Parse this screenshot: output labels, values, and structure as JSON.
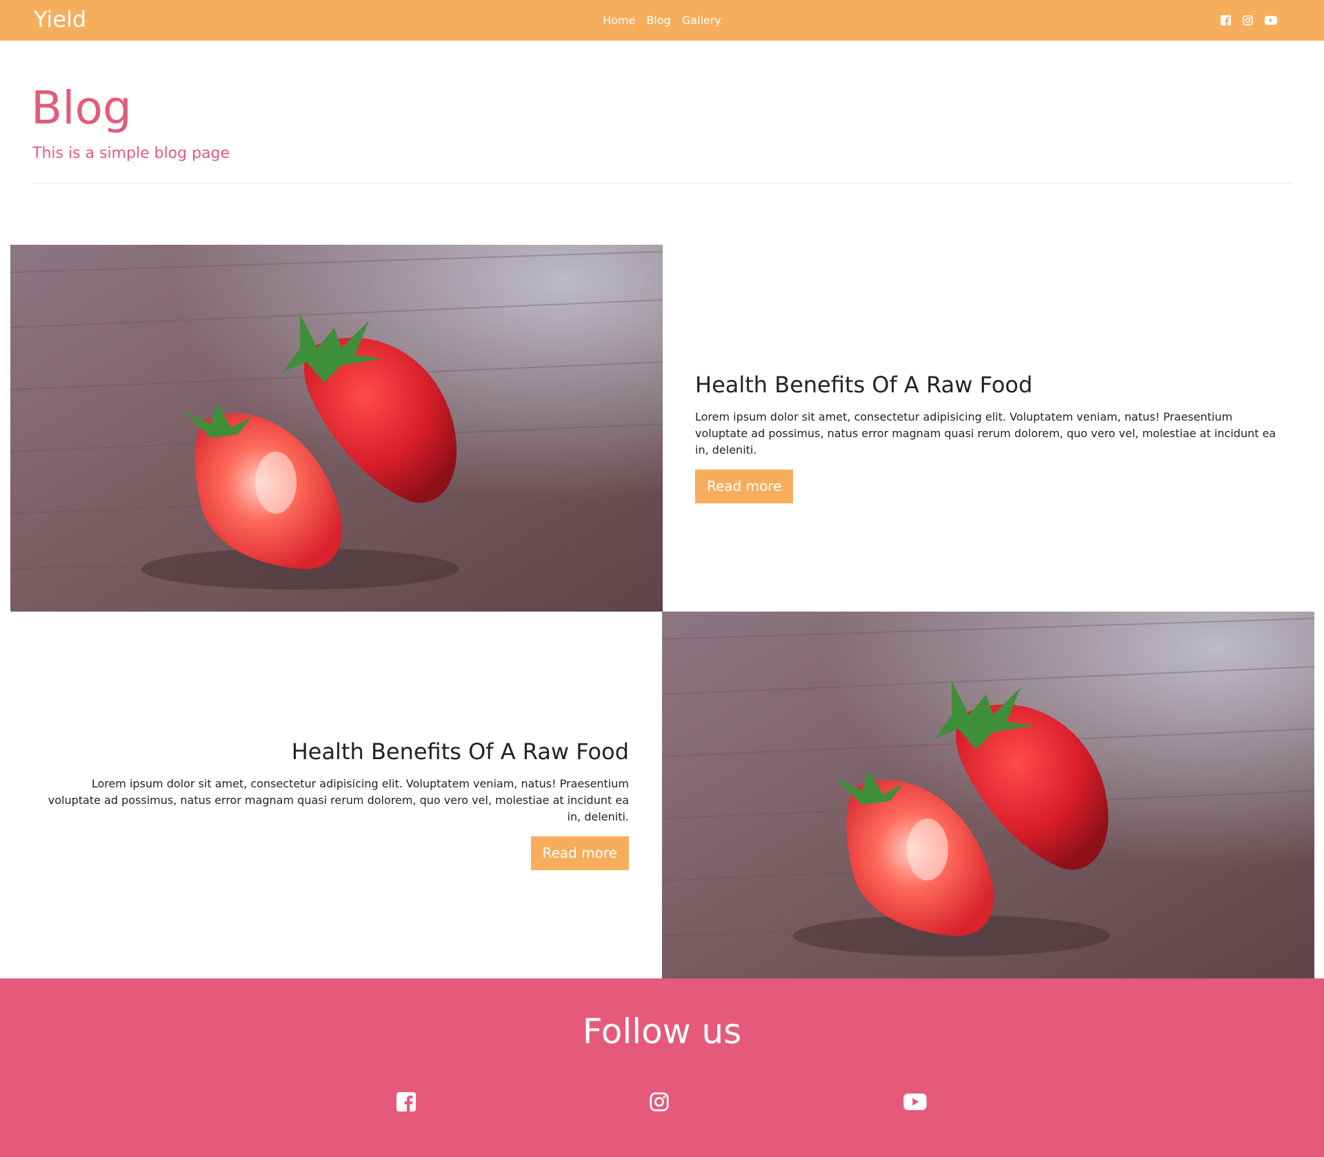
{
  "navbar": {
    "brand": "Yield",
    "links": [
      "Home",
      "Blog",
      "Gallery"
    ],
    "social_icons": [
      "facebook-icon",
      "instagram-icon",
      "youtube-icon"
    ],
    "background_color": "#f6ad5c"
  },
  "header": {
    "title": "Blog",
    "subtitle": "This is a simple blog page",
    "accent_color": "#e55a7b"
  },
  "posts": [
    {
      "title": "Health Benefits Of A Raw Food",
      "body": "Lorem ipsum dolor sit amet, consectetur adipisicing elit. Voluptatem veniam, natus! Praesentium voluptate ad possimus, natus error magnam quasi rerum dolorem, quo vero vel, molestiae at incidunt ea in, deleniti.",
      "button_label": "Read more",
      "image": "strawberries-photo"
    },
    {
      "title": "Health Benefits Of A Raw Food",
      "body": "Lorem ipsum dolor sit amet, consectetur adipisicing elit. Voluptatem veniam, natus! Praesentium voluptate ad possimus, natus error magnam quasi rerum dolorem, quo vero vel, molestiae at incidunt ea in, deleniti.",
      "button_label": "Read more",
      "image": "strawberries-photo"
    }
  ],
  "footer": {
    "title": "Follow us",
    "social_icons": [
      "facebook-icon",
      "instagram-icon",
      "youtube-icon"
    ],
    "background_color": "#e55a7b"
  }
}
